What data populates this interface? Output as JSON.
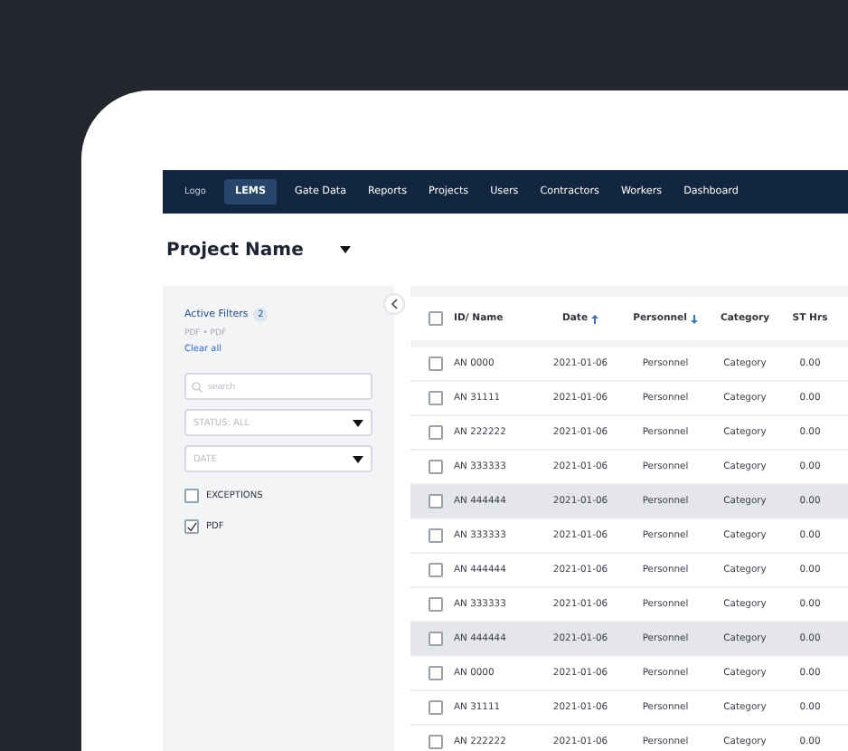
{
  "nav": {
    "logo": "Logo",
    "items": [
      {
        "label": "LEMS",
        "selected": true
      },
      {
        "label": "Gate Data",
        "selected": false
      },
      {
        "label": "Reports",
        "selected": false
      },
      {
        "label": "Projects",
        "selected": false
      },
      {
        "label": "Users",
        "selected": false
      },
      {
        "label": "Contractors",
        "selected": false
      },
      {
        "label": "Workers",
        "selected": false
      },
      {
        "label": "Dashboard",
        "selected": false
      }
    ]
  },
  "project": {
    "title": "Project Name"
  },
  "filters": {
    "heading": "Active Filters",
    "count": "2",
    "summary": "PDF • PDF",
    "clear": "Clear all",
    "search_placeholder": "search",
    "status": "STATUS: ALL",
    "date": "DATE",
    "options": [
      {
        "label": "EXCEPTIONS",
        "checked": false
      },
      {
        "label": "PDF",
        "checked": true
      }
    ]
  },
  "table": {
    "select_all_checked": false,
    "columns": [
      {
        "label": "ID/ Name",
        "kind": "plain"
      },
      {
        "label": "Date",
        "kind": "ascending"
      },
      {
        "label": "Personnel",
        "kind": "descending"
      },
      {
        "label": "Category",
        "kind": "plain"
      },
      {
        "label": "ST Hrs",
        "kind": "plain"
      }
    ],
    "rows": [
      {
        "id": "AN 0000",
        "date": "2021-01-06",
        "personnel": "Personnel",
        "category": "Category",
        "st_hrs": "0.00",
        "checked": false,
        "highlighted": false
      },
      {
        "id": "AN 31111",
        "date": "2021-01-06",
        "personnel": "Personnel",
        "category": "Category",
        "st_hrs": "0.00",
        "checked": false,
        "highlighted": false
      },
      {
        "id": "AN 222222",
        "date": "2021-01-06",
        "personnel": "Personnel",
        "category": "Category",
        "st_hrs": "0.00",
        "checked": false,
        "highlighted": false
      },
      {
        "id": "AN 333333",
        "date": "2021-01-06",
        "personnel": "Personnel",
        "category": "Category",
        "st_hrs": "0.00",
        "checked": false,
        "highlighted": false
      },
      {
        "id": "AN 444444",
        "date": "2021-01-06",
        "personnel": "Personnel",
        "category": "Category",
        "st_hrs": "0.00",
        "checked": false,
        "highlighted": true
      },
      {
        "id": "AN 333333",
        "date": "2021-01-06",
        "personnel": "Personnel",
        "category": "Category",
        "st_hrs": "0.00",
        "checked": false,
        "highlighted": false
      },
      {
        "id": "AN 444444",
        "date": "2021-01-06",
        "personnel": "Personnel",
        "category": "Category",
        "st_hrs": "0.00",
        "checked": false,
        "highlighted": false
      },
      {
        "id": "AN 333333",
        "date": "2021-01-06",
        "personnel": "Personnel",
        "category": "Category",
        "st_hrs": "0.00",
        "checked": false,
        "highlighted": false
      },
      {
        "id": "AN 444444",
        "date": "2021-01-06",
        "personnel": "Personnel",
        "category": "Category",
        "st_hrs": "0.00",
        "checked": false,
        "highlighted": true
      },
      {
        "id": "AN 0000",
        "date": "2021-01-06",
        "personnel": "Personnel",
        "category": "Category",
        "st_hrs": "0.00",
        "checked": false,
        "highlighted": false
      },
      {
        "id": "AN 31111",
        "date": "2021-01-06",
        "personnel": "Personnel",
        "category": "Category",
        "st_hrs": "0.00",
        "checked": false,
        "highlighted": false
      },
      {
        "id": "AN 222222",
        "date": "2021-01-06",
        "personnel": "Personnel",
        "category": "Category",
        "st_hrs": "0.00",
        "checked": false,
        "highlighted": false
      }
    ]
  }
}
